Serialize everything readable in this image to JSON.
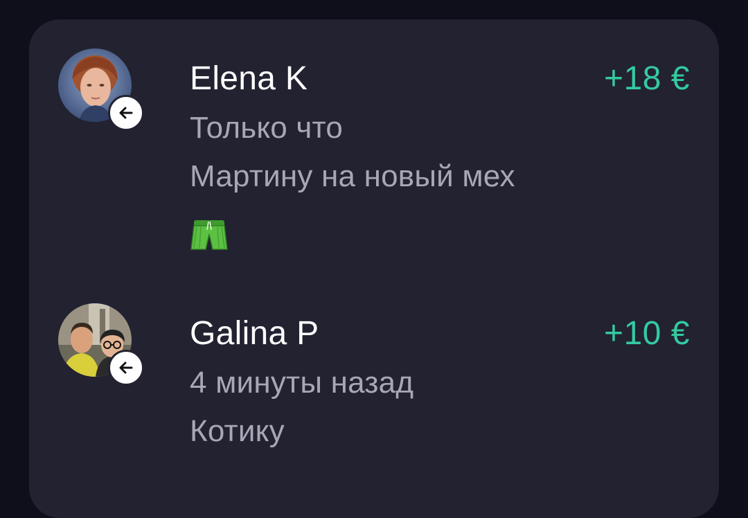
{
  "transactions": [
    {
      "name": "Elena K",
      "amount": "+18 €",
      "time": "Только что",
      "comment": "Мартину на новый мех",
      "emoji_icon": "green-shorts-emoji",
      "direction_icon": "arrow-left-icon"
    },
    {
      "name": "Galina P",
      "amount": "+10 €",
      "time": "4 минуты назад",
      "comment": "Котику",
      "direction_icon": "arrow-left-icon"
    }
  ],
  "colors": {
    "background": "#0f0f1b",
    "card": "#222231",
    "amount_positive": "#35c9a0",
    "name": "#ffffff",
    "secondary_text": "#a7a7b6"
  }
}
